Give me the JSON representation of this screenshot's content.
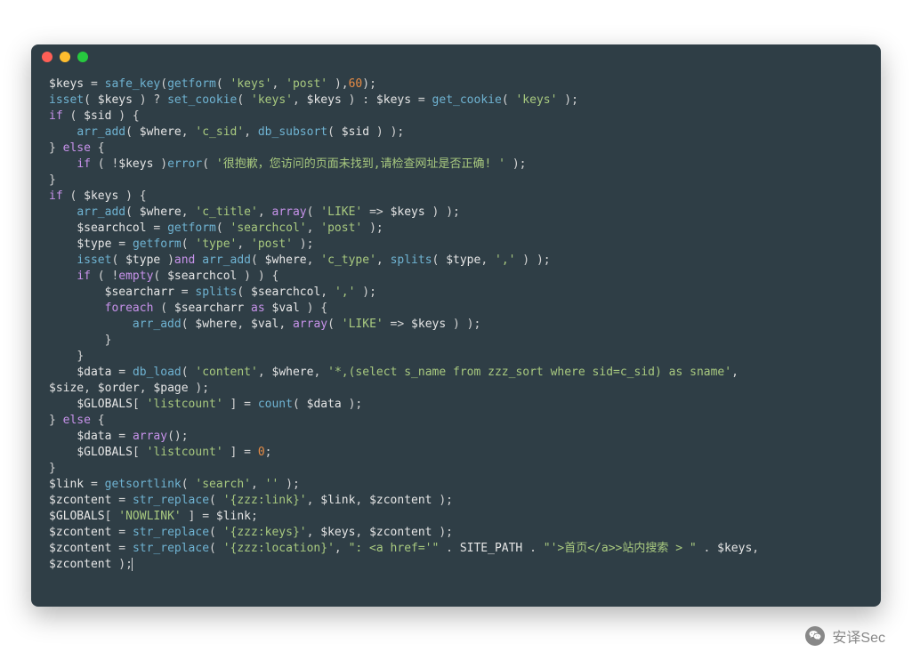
{
  "window": {
    "traffic_lights": [
      "red",
      "yellow",
      "green"
    ]
  },
  "code": {
    "lines": [
      [
        {
          "t": "var",
          "v": "$keys"
        },
        {
          "t": "op",
          "v": " = "
        },
        {
          "t": "func",
          "v": "safe_key"
        },
        {
          "t": "bracket",
          "v": "("
        },
        {
          "t": "func",
          "v": "getform"
        },
        {
          "t": "bracket",
          "v": "( "
        },
        {
          "t": "str",
          "v": "'keys'"
        },
        {
          "t": "op",
          "v": ", "
        },
        {
          "t": "str",
          "v": "'post'"
        },
        {
          "t": "bracket",
          "v": " )"
        },
        {
          "t": "op",
          "v": ","
        },
        {
          "t": "num",
          "v": "60"
        },
        {
          "t": "bracket",
          "v": ")"
        },
        {
          "t": "op",
          "v": ";"
        }
      ],
      [
        {
          "t": "func",
          "v": "isset"
        },
        {
          "t": "bracket",
          "v": "( "
        },
        {
          "t": "var",
          "v": "$keys"
        },
        {
          "t": "bracket",
          "v": " )"
        },
        {
          "t": "op",
          "v": " ? "
        },
        {
          "t": "func",
          "v": "set_cookie"
        },
        {
          "t": "bracket",
          "v": "( "
        },
        {
          "t": "str",
          "v": "'keys'"
        },
        {
          "t": "op",
          "v": ", "
        },
        {
          "t": "var",
          "v": "$keys"
        },
        {
          "t": "bracket",
          "v": " )"
        },
        {
          "t": "op",
          "v": " : "
        },
        {
          "t": "var",
          "v": "$keys"
        },
        {
          "t": "op",
          "v": " = "
        },
        {
          "t": "func",
          "v": "get_cookie"
        },
        {
          "t": "bracket",
          "v": "( "
        },
        {
          "t": "str",
          "v": "'keys'"
        },
        {
          "t": "bracket",
          "v": " )"
        },
        {
          "t": "op",
          "v": ";"
        }
      ],
      [
        {
          "t": "key",
          "v": "if"
        },
        {
          "t": "bracket",
          "v": " ( "
        },
        {
          "t": "var",
          "v": "$sid"
        },
        {
          "t": "bracket",
          "v": " ) {"
        }
      ],
      [
        {
          "t": "op",
          "v": "    "
        },
        {
          "t": "func",
          "v": "arr_add"
        },
        {
          "t": "bracket",
          "v": "( "
        },
        {
          "t": "var",
          "v": "$where"
        },
        {
          "t": "op",
          "v": ", "
        },
        {
          "t": "str",
          "v": "'c_sid'"
        },
        {
          "t": "op",
          "v": ", "
        },
        {
          "t": "func",
          "v": "db_subsort"
        },
        {
          "t": "bracket",
          "v": "( "
        },
        {
          "t": "var",
          "v": "$sid"
        },
        {
          "t": "bracket",
          "v": " ) )"
        },
        {
          "t": "op",
          "v": ";"
        }
      ],
      [
        {
          "t": "bracket",
          "v": "} "
        },
        {
          "t": "key",
          "v": "else"
        },
        {
          "t": "bracket",
          "v": " {"
        }
      ],
      [
        {
          "t": "op",
          "v": "    "
        },
        {
          "t": "key",
          "v": "if"
        },
        {
          "t": "bracket",
          "v": " ( "
        },
        {
          "t": "op",
          "v": "!"
        },
        {
          "t": "var",
          "v": "$keys"
        },
        {
          "t": "bracket",
          "v": " )"
        },
        {
          "t": "func",
          "v": "error"
        },
        {
          "t": "bracket",
          "v": "( "
        },
        {
          "t": "str",
          "v": "'很抱歉，您访问的页面未找到,请检查网址是否正确! '"
        },
        {
          "t": "bracket",
          "v": " )"
        },
        {
          "t": "op",
          "v": ";"
        }
      ],
      [
        {
          "t": "bracket",
          "v": "}"
        }
      ],
      [
        {
          "t": "key",
          "v": "if"
        },
        {
          "t": "bracket",
          "v": " ( "
        },
        {
          "t": "var",
          "v": "$keys"
        },
        {
          "t": "bracket",
          "v": " ) {"
        }
      ],
      [
        {
          "t": "op",
          "v": "    "
        },
        {
          "t": "func",
          "v": "arr_add"
        },
        {
          "t": "bracket",
          "v": "( "
        },
        {
          "t": "var",
          "v": "$where"
        },
        {
          "t": "op",
          "v": ", "
        },
        {
          "t": "str",
          "v": "'c_title'"
        },
        {
          "t": "op",
          "v": ", "
        },
        {
          "t": "key",
          "v": "array"
        },
        {
          "t": "bracket",
          "v": "( "
        },
        {
          "t": "str",
          "v": "'LIKE'"
        },
        {
          "t": "op",
          "v": " => "
        },
        {
          "t": "var",
          "v": "$keys"
        },
        {
          "t": "bracket",
          "v": " ) )"
        },
        {
          "t": "op",
          "v": ";"
        }
      ],
      [
        {
          "t": "op",
          "v": "    "
        },
        {
          "t": "var",
          "v": "$searchcol"
        },
        {
          "t": "op",
          "v": " = "
        },
        {
          "t": "func",
          "v": "getform"
        },
        {
          "t": "bracket",
          "v": "( "
        },
        {
          "t": "str",
          "v": "'searchcol'"
        },
        {
          "t": "op",
          "v": ", "
        },
        {
          "t": "str",
          "v": "'post'"
        },
        {
          "t": "bracket",
          "v": " )"
        },
        {
          "t": "op",
          "v": ";"
        }
      ],
      [
        {
          "t": "op",
          "v": "    "
        },
        {
          "t": "var",
          "v": "$type"
        },
        {
          "t": "op",
          "v": " = "
        },
        {
          "t": "func",
          "v": "getform"
        },
        {
          "t": "bracket",
          "v": "( "
        },
        {
          "t": "str",
          "v": "'type'"
        },
        {
          "t": "op",
          "v": ", "
        },
        {
          "t": "str",
          "v": "'post'"
        },
        {
          "t": "bracket",
          "v": " )"
        },
        {
          "t": "op",
          "v": ";"
        }
      ],
      [
        {
          "t": "op",
          "v": "    "
        },
        {
          "t": "func",
          "v": "isset"
        },
        {
          "t": "bracket",
          "v": "( "
        },
        {
          "t": "var",
          "v": "$type"
        },
        {
          "t": "bracket",
          "v": " )"
        },
        {
          "t": "key",
          "v": "and"
        },
        {
          "t": "op",
          "v": " "
        },
        {
          "t": "func",
          "v": "arr_add"
        },
        {
          "t": "bracket",
          "v": "( "
        },
        {
          "t": "var",
          "v": "$where"
        },
        {
          "t": "op",
          "v": ", "
        },
        {
          "t": "str",
          "v": "'c_type'"
        },
        {
          "t": "op",
          "v": ", "
        },
        {
          "t": "func",
          "v": "splits"
        },
        {
          "t": "bracket",
          "v": "( "
        },
        {
          "t": "var",
          "v": "$type"
        },
        {
          "t": "op",
          "v": ", "
        },
        {
          "t": "str",
          "v": "','"
        },
        {
          "t": "bracket",
          "v": " ) )"
        },
        {
          "t": "op",
          "v": ";"
        }
      ],
      [
        {
          "t": "op",
          "v": "    "
        },
        {
          "t": "key",
          "v": "if"
        },
        {
          "t": "bracket",
          "v": " ( "
        },
        {
          "t": "op",
          "v": "!"
        },
        {
          "t": "key",
          "v": "empty"
        },
        {
          "t": "bracket",
          "v": "( "
        },
        {
          "t": "var",
          "v": "$searchcol"
        },
        {
          "t": "bracket",
          "v": " ) ) {"
        }
      ],
      [
        {
          "t": "op",
          "v": "        "
        },
        {
          "t": "var",
          "v": "$searcharr"
        },
        {
          "t": "op",
          "v": " = "
        },
        {
          "t": "func",
          "v": "splits"
        },
        {
          "t": "bracket",
          "v": "( "
        },
        {
          "t": "var",
          "v": "$searchcol"
        },
        {
          "t": "op",
          "v": ", "
        },
        {
          "t": "str",
          "v": "','"
        },
        {
          "t": "bracket",
          "v": " )"
        },
        {
          "t": "op",
          "v": ";"
        }
      ],
      [
        {
          "t": "op",
          "v": "        "
        },
        {
          "t": "key",
          "v": "foreach"
        },
        {
          "t": "bracket",
          "v": " ( "
        },
        {
          "t": "var",
          "v": "$searcharr"
        },
        {
          "t": "op",
          "v": " "
        },
        {
          "t": "key",
          "v": "as"
        },
        {
          "t": "op",
          "v": " "
        },
        {
          "t": "var",
          "v": "$val"
        },
        {
          "t": "bracket",
          "v": " ) {"
        }
      ],
      [
        {
          "t": "op",
          "v": "            "
        },
        {
          "t": "func",
          "v": "arr_add"
        },
        {
          "t": "bracket",
          "v": "( "
        },
        {
          "t": "var",
          "v": "$where"
        },
        {
          "t": "op",
          "v": ", "
        },
        {
          "t": "var",
          "v": "$val"
        },
        {
          "t": "op",
          "v": ", "
        },
        {
          "t": "key",
          "v": "array"
        },
        {
          "t": "bracket",
          "v": "( "
        },
        {
          "t": "str",
          "v": "'LIKE'"
        },
        {
          "t": "op",
          "v": " => "
        },
        {
          "t": "var",
          "v": "$keys"
        },
        {
          "t": "bracket",
          "v": " ) )"
        },
        {
          "t": "op",
          "v": ";"
        }
      ],
      [
        {
          "t": "op",
          "v": "        "
        },
        {
          "t": "bracket",
          "v": "}"
        }
      ],
      [
        {
          "t": "op",
          "v": "    "
        },
        {
          "t": "bracket",
          "v": "}"
        }
      ],
      [
        {
          "t": "op",
          "v": "    "
        },
        {
          "t": "var",
          "v": "$data"
        },
        {
          "t": "op",
          "v": " = "
        },
        {
          "t": "func",
          "v": "db_load"
        },
        {
          "t": "bracket",
          "v": "( "
        },
        {
          "t": "str",
          "v": "'content'"
        },
        {
          "t": "op",
          "v": ", "
        },
        {
          "t": "var",
          "v": "$where"
        },
        {
          "t": "op",
          "v": ", "
        },
        {
          "t": "str",
          "v": "'*,(select s_name from zzz_sort where sid=c_sid) as sname'"
        },
        {
          "t": "op",
          "v": ", "
        }
      ],
      [
        {
          "t": "var",
          "v": "$size"
        },
        {
          "t": "op",
          "v": ", "
        },
        {
          "t": "var",
          "v": "$order"
        },
        {
          "t": "op",
          "v": ", "
        },
        {
          "t": "var",
          "v": "$page"
        },
        {
          "t": "bracket",
          "v": " )"
        },
        {
          "t": "op",
          "v": ";"
        }
      ],
      [
        {
          "t": "op",
          "v": "    "
        },
        {
          "t": "var",
          "v": "$GLOBALS"
        },
        {
          "t": "bracket",
          "v": "[ "
        },
        {
          "t": "str",
          "v": "'listcount'"
        },
        {
          "t": "bracket",
          "v": " ]"
        },
        {
          "t": "op",
          "v": " = "
        },
        {
          "t": "func",
          "v": "count"
        },
        {
          "t": "bracket",
          "v": "( "
        },
        {
          "t": "var",
          "v": "$data"
        },
        {
          "t": "bracket",
          "v": " )"
        },
        {
          "t": "op",
          "v": ";"
        }
      ],
      [
        {
          "t": "bracket",
          "v": "} "
        },
        {
          "t": "key",
          "v": "else"
        },
        {
          "t": "bracket",
          "v": " {"
        }
      ],
      [
        {
          "t": "op",
          "v": "    "
        },
        {
          "t": "var",
          "v": "$data"
        },
        {
          "t": "op",
          "v": " = "
        },
        {
          "t": "key",
          "v": "array"
        },
        {
          "t": "bracket",
          "v": "()"
        },
        {
          "t": "op",
          "v": ";"
        }
      ],
      [
        {
          "t": "op",
          "v": "    "
        },
        {
          "t": "var",
          "v": "$GLOBALS"
        },
        {
          "t": "bracket",
          "v": "[ "
        },
        {
          "t": "str",
          "v": "'listcount'"
        },
        {
          "t": "bracket",
          "v": " ]"
        },
        {
          "t": "op",
          "v": " = "
        },
        {
          "t": "num",
          "v": "0"
        },
        {
          "t": "op",
          "v": ";"
        }
      ],
      [
        {
          "t": "bracket",
          "v": "}"
        }
      ],
      [
        {
          "t": "var",
          "v": "$link"
        },
        {
          "t": "op",
          "v": " = "
        },
        {
          "t": "func",
          "v": "getsortlink"
        },
        {
          "t": "bracket",
          "v": "( "
        },
        {
          "t": "str",
          "v": "'search'"
        },
        {
          "t": "op",
          "v": ", "
        },
        {
          "t": "str",
          "v": "''"
        },
        {
          "t": "bracket",
          "v": " )"
        },
        {
          "t": "op",
          "v": ";"
        }
      ],
      [
        {
          "t": "var",
          "v": "$zcontent"
        },
        {
          "t": "op",
          "v": " = "
        },
        {
          "t": "func",
          "v": "str_replace"
        },
        {
          "t": "bracket",
          "v": "( "
        },
        {
          "t": "str",
          "v": "'{zzz:link}'"
        },
        {
          "t": "op",
          "v": ", "
        },
        {
          "t": "var",
          "v": "$link"
        },
        {
          "t": "op",
          "v": ", "
        },
        {
          "t": "var",
          "v": "$zcontent"
        },
        {
          "t": "bracket",
          "v": " )"
        },
        {
          "t": "op",
          "v": ";"
        }
      ],
      [
        {
          "t": "var",
          "v": "$GLOBALS"
        },
        {
          "t": "bracket",
          "v": "[ "
        },
        {
          "t": "str",
          "v": "'NOWLINK'"
        },
        {
          "t": "bracket",
          "v": " ]"
        },
        {
          "t": "op",
          "v": " = "
        },
        {
          "t": "var",
          "v": "$link"
        },
        {
          "t": "op",
          "v": ";"
        }
      ],
      [
        {
          "t": "var",
          "v": "$zcontent"
        },
        {
          "t": "op",
          "v": " = "
        },
        {
          "t": "func",
          "v": "str_replace"
        },
        {
          "t": "bracket",
          "v": "( "
        },
        {
          "t": "str",
          "v": "'{zzz:keys}'"
        },
        {
          "t": "op",
          "v": ", "
        },
        {
          "t": "var",
          "v": "$keys"
        },
        {
          "t": "op",
          "v": ", "
        },
        {
          "t": "var",
          "v": "$zcontent"
        },
        {
          "t": "bracket",
          "v": " )"
        },
        {
          "t": "op",
          "v": ";"
        }
      ],
      [
        {
          "t": "var",
          "v": "$zcontent"
        },
        {
          "t": "op",
          "v": " = "
        },
        {
          "t": "func",
          "v": "str_replace"
        },
        {
          "t": "bracket",
          "v": "( "
        },
        {
          "t": "str",
          "v": "'{zzz:location}'"
        },
        {
          "t": "op",
          "v": ", "
        },
        {
          "t": "str",
          "v": "\": <a href='\""
        },
        {
          "t": "op",
          "v": " . "
        },
        {
          "t": "const",
          "v": "SITE_PATH"
        },
        {
          "t": "op",
          "v": " . "
        },
        {
          "t": "str",
          "v": "\"'>首页</a>>站内搜索 > \""
        },
        {
          "t": "op",
          "v": " . "
        },
        {
          "t": "var",
          "v": "$keys"
        },
        {
          "t": "op",
          "v": ", "
        }
      ],
      [
        {
          "t": "var",
          "v": "$zcontent"
        },
        {
          "t": "bracket",
          "v": " )"
        },
        {
          "t": "op",
          "v": ";"
        },
        {
          "t": "cursor",
          "v": ""
        }
      ]
    ]
  },
  "watermark": {
    "text": "安译Sec"
  }
}
